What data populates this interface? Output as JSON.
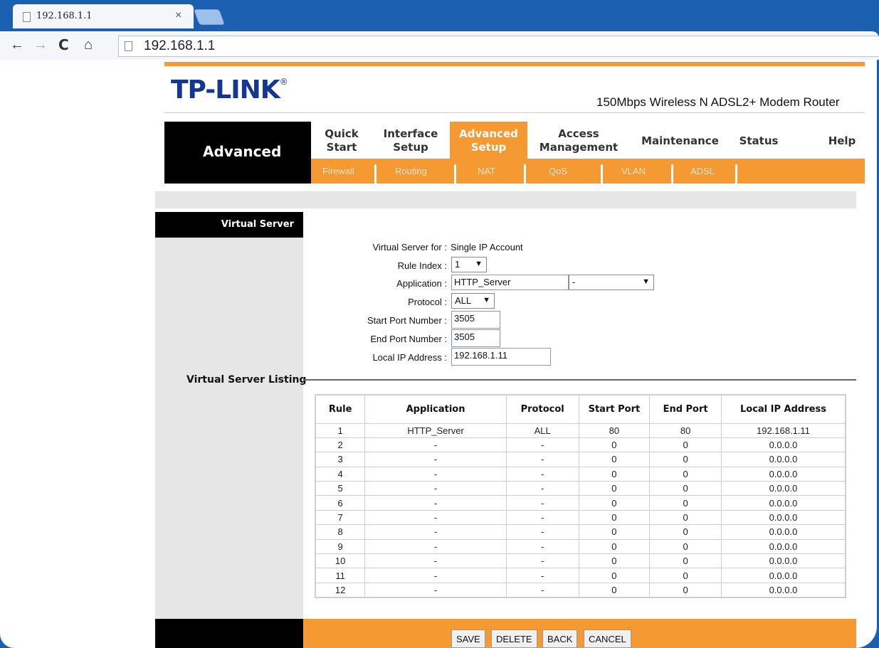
{
  "browser": {
    "tab_title": "192.168.1.1",
    "tab_close": "×",
    "url": "192.168.1.1",
    "back": "←",
    "forward": "→",
    "reload": "C",
    "home": "⌂"
  },
  "header": {
    "logo": "TP-LINK",
    "logo_mark": "®",
    "model": "150Mbps Wireless N ADSL2+ Modem Router",
    "section": "Advanced"
  },
  "menu": [
    {
      "l1": "Quick",
      "l2": "Start"
    },
    {
      "l1": "Interface",
      "l2": "Setup"
    },
    {
      "l1": "Advanced",
      "l2": "Setup"
    },
    {
      "l1": "Access",
      "l2": "Management"
    },
    {
      "l1": "Maintenance"
    },
    {
      "l1": "Status"
    },
    {
      "l1": "Help"
    }
  ],
  "submenu": [
    "Firewall",
    "Routing",
    "NAT",
    "QoS",
    "VLAN",
    "ADSL"
  ],
  "side": {
    "title": "Virtual Server",
    "listing": "Virtual Server Listing"
  },
  "form": {
    "for_label": "Virtual Server for :",
    "for_value": "Single IP Account",
    "rule_index_label": "Rule Index :",
    "rule_index": "1",
    "application_label": "Application :",
    "application": "HTTP_Server",
    "application_select": "-",
    "protocol_label": "Protocol :",
    "protocol": "ALL",
    "start_port_label": "Start Port Number :",
    "start_port": "3505",
    "end_port_label": "End Port Number :",
    "end_port": "3505",
    "local_ip_label": "Local IP Address :",
    "local_ip": "192.168.1.11"
  },
  "table": {
    "headers": [
      "Rule",
      "Application",
      "Protocol",
      "Start Port",
      "End Port",
      "Local IP Address"
    ],
    "rows": [
      [
        "1",
        "HTTP_Server",
        "ALL",
        "80",
        "80",
        "192.168.1.11"
      ],
      [
        "2",
        "-",
        "-",
        "0",
        "0",
        "0.0.0.0"
      ],
      [
        "3",
        "-",
        "-",
        "0",
        "0",
        "0.0.0.0"
      ],
      [
        "4",
        "-",
        "-",
        "0",
        "0",
        "0.0.0.0"
      ],
      [
        "5",
        "-",
        "-",
        "0",
        "0",
        "0.0.0.0"
      ],
      [
        "6",
        "-",
        "-",
        "0",
        "0",
        "0.0.0.0"
      ],
      [
        "7",
        "-",
        "-",
        "0",
        "0",
        "0.0.0.0"
      ],
      [
        "8",
        "-",
        "-",
        "0",
        "0",
        "0.0.0.0"
      ],
      [
        "9",
        "-",
        "-",
        "0",
        "0",
        "0.0.0.0"
      ],
      [
        "10",
        "-",
        "-",
        "0",
        "0",
        "0.0.0.0"
      ],
      [
        "11",
        "-",
        "-",
        "0",
        "0",
        "0.0.0.0"
      ],
      [
        "12",
        "-",
        "-",
        "0",
        "0",
        "0.0.0.0"
      ]
    ]
  },
  "buttons": {
    "save": "SAVE",
    "delete": "DELETE",
    "back": "BACK",
    "cancel": "CANCEL"
  },
  "colors": {
    "accent_orange": "#f59a33",
    "logo_blue": "#16378f",
    "frame_blue": "#1b5fb0"
  }
}
